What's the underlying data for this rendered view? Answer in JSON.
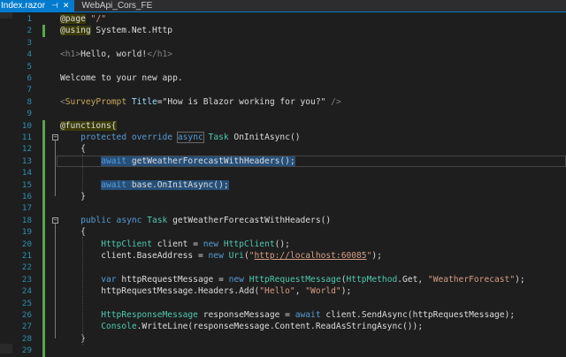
{
  "tabs": [
    {
      "name": "Index.razor",
      "pin": "⊣",
      "close": "✕",
      "active": true
    },
    {
      "name": "WebApi_Cors_FE",
      "active": false
    }
  ],
  "lines": [
    {
      "num": "1",
      "tokens": [
        {
          "t": "@page",
          "c": "dir"
        },
        {
          "t": " "
        },
        {
          "t": "\"/\"",
          "c": "st"
        }
      ]
    },
    {
      "num": "2",
      "tokens": [
        {
          "t": "@using",
          "c": "dir"
        },
        {
          "t": " System.Net.Http"
        }
      ]
    },
    {
      "num": "3",
      "tokens": []
    },
    {
      "num": "4",
      "tokens": [
        {
          "t": "<h1>",
          "c": "tg"
        },
        {
          "t": "Hello, world!"
        },
        {
          "t": "</h1>",
          "c": "tg"
        }
      ]
    },
    {
      "num": "5",
      "tokens": []
    },
    {
      "num": "6",
      "tokens": [
        {
          "t": "Welcome to your new app."
        }
      ]
    },
    {
      "num": "7",
      "tokens": []
    },
    {
      "num": "8",
      "tokens": [
        {
          "t": "<",
          "c": "tg"
        },
        {
          "t": "SurveyPrompt",
          "c": "tn"
        },
        {
          "t": " "
        },
        {
          "t": "Title",
          "c": "an"
        },
        {
          "t": "="
        },
        {
          "t": "\"How is Blazor working for you?\""
        },
        {
          "t": " />",
          "c": "tg"
        }
      ]
    },
    {
      "num": "9",
      "tokens": []
    },
    {
      "num": "10",
      "tokens": [
        {
          "t": "@functions{",
          "c": "dir"
        }
      ]
    },
    {
      "num": "11",
      "tokens": [
        {
          "t": "    "
        },
        {
          "t": "protected",
          "c": "kw"
        },
        {
          "t": " "
        },
        {
          "t": "override",
          "c": "kw"
        },
        {
          "t": " "
        },
        {
          "t": "async",
          "c": "kw kbox"
        },
        {
          "t": " "
        },
        {
          "t": "Task",
          "c": "ty"
        },
        {
          "t": " OnInitAsync()"
        }
      ]
    },
    {
      "num": "12",
      "tokens": [
        {
          "t": "    {"
        }
      ]
    },
    {
      "num": "13",
      "tokens": [
        {
          "t": "        "
        },
        {
          "t": "await",
          "c": "kw hl"
        },
        {
          "t": " getWeatherForecastWithHeaders();",
          "c": "hl"
        }
      ]
    },
    {
      "num": "14",
      "tokens": []
    },
    {
      "num": "15",
      "tokens": [
        {
          "t": "        "
        },
        {
          "t": "await",
          "c": "kw hl"
        },
        {
          "t": " base.OnInitAsync();",
          "c": "hl"
        }
      ]
    },
    {
      "num": "16",
      "tokens": [
        {
          "t": "    }"
        }
      ]
    },
    {
      "num": "17",
      "tokens": []
    },
    {
      "num": "18",
      "tokens": [
        {
          "t": "    "
        },
        {
          "t": "public",
          "c": "kw"
        },
        {
          "t": " "
        },
        {
          "t": "async",
          "c": "kw"
        },
        {
          "t": " "
        },
        {
          "t": "Task",
          "c": "ty"
        },
        {
          "t": " getWeatherForecastWithHeaders()"
        }
      ]
    },
    {
      "num": "19",
      "tokens": [
        {
          "t": "    {"
        }
      ]
    },
    {
      "num": "20",
      "tokens": [
        {
          "t": "        "
        },
        {
          "t": "HttpClient",
          "c": "ty"
        },
        {
          "t": " client = "
        },
        {
          "t": "new",
          "c": "kw"
        },
        {
          "t": " "
        },
        {
          "t": "HttpClient",
          "c": "ty"
        },
        {
          "t": "();"
        }
      ]
    },
    {
      "num": "21",
      "tokens": [
        {
          "t": "        client.BaseAddress = "
        },
        {
          "t": "new",
          "c": "kw"
        },
        {
          "t": " "
        },
        {
          "t": "Uri",
          "c": "ty"
        },
        {
          "t": "("
        },
        {
          "t": "\"",
          "c": "st"
        },
        {
          "t": "http://localhost:60085",
          "c": "lk"
        },
        {
          "t": "\"",
          "c": "st"
        },
        {
          "t": ");"
        }
      ]
    },
    {
      "num": "22",
      "tokens": []
    },
    {
      "num": "23",
      "tokens": [
        {
          "t": "        "
        },
        {
          "t": "var",
          "c": "kw"
        },
        {
          "t": " httpRequestMessage = "
        },
        {
          "t": "new",
          "c": "kw"
        },
        {
          "t": " "
        },
        {
          "t": "HttpRequestMessage",
          "c": "ty"
        },
        {
          "t": "("
        },
        {
          "t": "HttpMethod",
          "c": "ty"
        },
        {
          "t": ".Get, "
        },
        {
          "t": "\"WeatherForecast\"",
          "c": "st"
        },
        {
          "t": ");"
        }
      ]
    },
    {
      "num": "24",
      "tokens": [
        {
          "t": "        httpRequestMessage.Headers.Add("
        },
        {
          "t": "\"Hello\"",
          "c": "st"
        },
        {
          "t": ", "
        },
        {
          "t": "\"World\"",
          "c": "st"
        },
        {
          "t": ");"
        }
      ]
    },
    {
      "num": "25",
      "tokens": []
    },
    {
      "num": "26",
      "tokens": [
        {
          "t": "        "
        },
        {
          "t": "HttpResponseMessage",
          "c": "ty"
        },
        {
          "t": " responseMessage = "
        },
        {
          "t": "await",
          "c": "kw"
        },
        {
          "t": " client.SendAsync(httpRequestMessage);"
        }
      ]
    },
    {
      "num": "27",
      "tokens": [
        {
          "t": "        "
        },
        {
          "t": "Console",
          "c": "ty"
        },
        {
          "t": ".WriteLine(responseMessage.Content.ReadAsStringAsync());"
        }
      ]
    },
    {
      "num": "28",
      "tokens": [
        {
          "t": "    }"
        }
      ]
    },
    {
      "num": "29",
      "tokens": []
    }
  ],
  "colors": {
    "accent": "#007acc",
    "keyword": "#569cd6",
    "type": "#4ec9b0",
    "string": "#d69d85",
    "line_number": "#2b91af"
  }
}
